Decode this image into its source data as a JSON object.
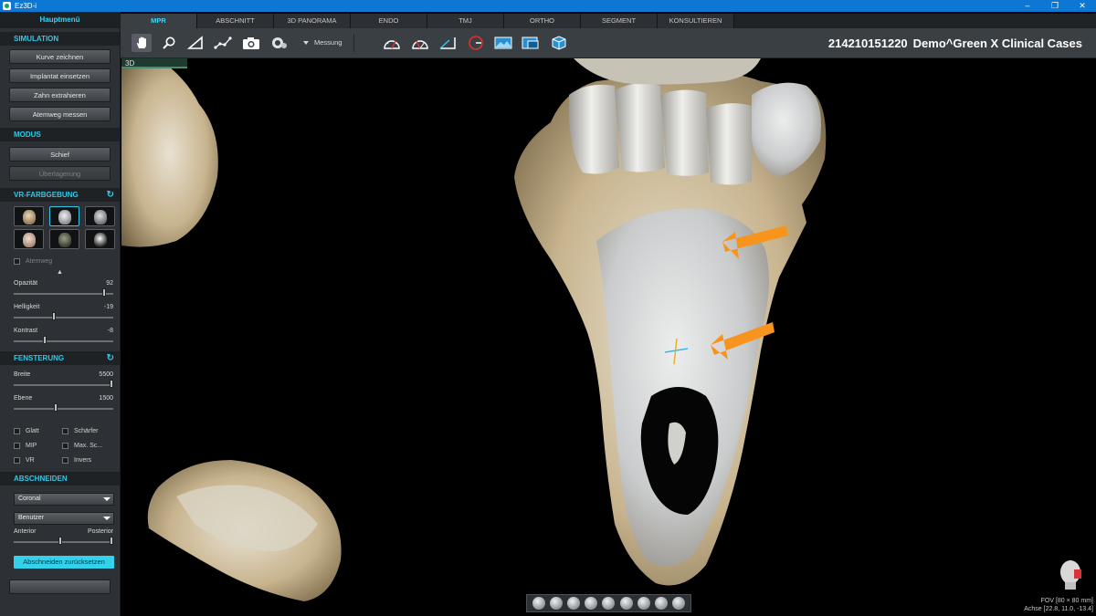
{
  "window": {
    "title": "Ez3D-i",
    "minimize": "–",
    "maximize": "❐",
    "close": "✕"
  },
  "left_panel": {
    "main_menu": "Hauptmenü",
    "simulation": {
      "header": "SIMULATION",
      "buttons": [
        "Kurve zeichnen",
        "Implantat einsetzen",
        "Zahn extrahieren",
        "Atemweg messen"
      ]
    },
    "modus": {
      "header": "MODUS",
      "buttons": [
        "Schief",
        "Überlagerung"
      ]
    },
    "vr_coloring": {
      "header": "VR-FARBGEBUNG",
      "presets": [
        "bone-head-preset-1",
        "bone-head-preset-2",
        "bone-head-preset-3",
        "skin-head-preset",
        "dark-head-preset",
        "skull-preset"
      ],
      "airway_label": "Atemweg"
    },
    "opacity": {
      "label": "Opazität",
      "value": "92",
      "fraction": 0.92
    },
    "brightness": {
      "label": "Helligkeit",
      "value": "-19",
      "fraction": 0.4
    },
    "contrast": {
      "label": "Kontrast",
      "value": "-8",
      "fraction": 0.3
    },
    "windowing": {
      "header": "FENSTERUNG",
      "width": {
        "label": "Breite",
        "value": "5500",
        "fraction": 1.0
      },
      "level": {
        "label": "Ebene",
        "value": "1500",
        "fraction": 0.42
      },
      "checkboxes": [
        [
          "Glatt",
          "Schärfer"
        ],
        [
          "MIP",
          "Max. Sc..."
        ],
        [
          "VR",
          "Invers"
        ]
      ]
    },
    "clipping": {
      "header": "ABSCHNEIDEN",
      "plane": "Coronal",
      "mode": "Benutzer",
      "anterior": "Anterior",
      "posterior": "Posterior",
      "reset_button": "Abschneiden zurücksetzen"
    }
  },
  "tabs": {
    "items": [
      "MPR",
      "ABSCHNITT",
      "3D PANORAMA",
      "ENDO",
      "TMJ",
      "ORTHO",
      "SEGMENT",
      "KONSULTIEREN"
    ],
    "active": 0
  },
  "toolbar": {
    "measure_label": "Messung",
    "patient_id": "214210151220",
    "patient_name": "Demo^Green X Clinical Cases"
  },
  "viewport": {
    "label": "3D",
    "fov": "FOV [80 × 80 mm]",
    "axis": "Achse [22.8, 11.0, -13.4]",
    "arrow_color": "#f7941d",
    "bone_color": "#dcdedf"
  }
}
